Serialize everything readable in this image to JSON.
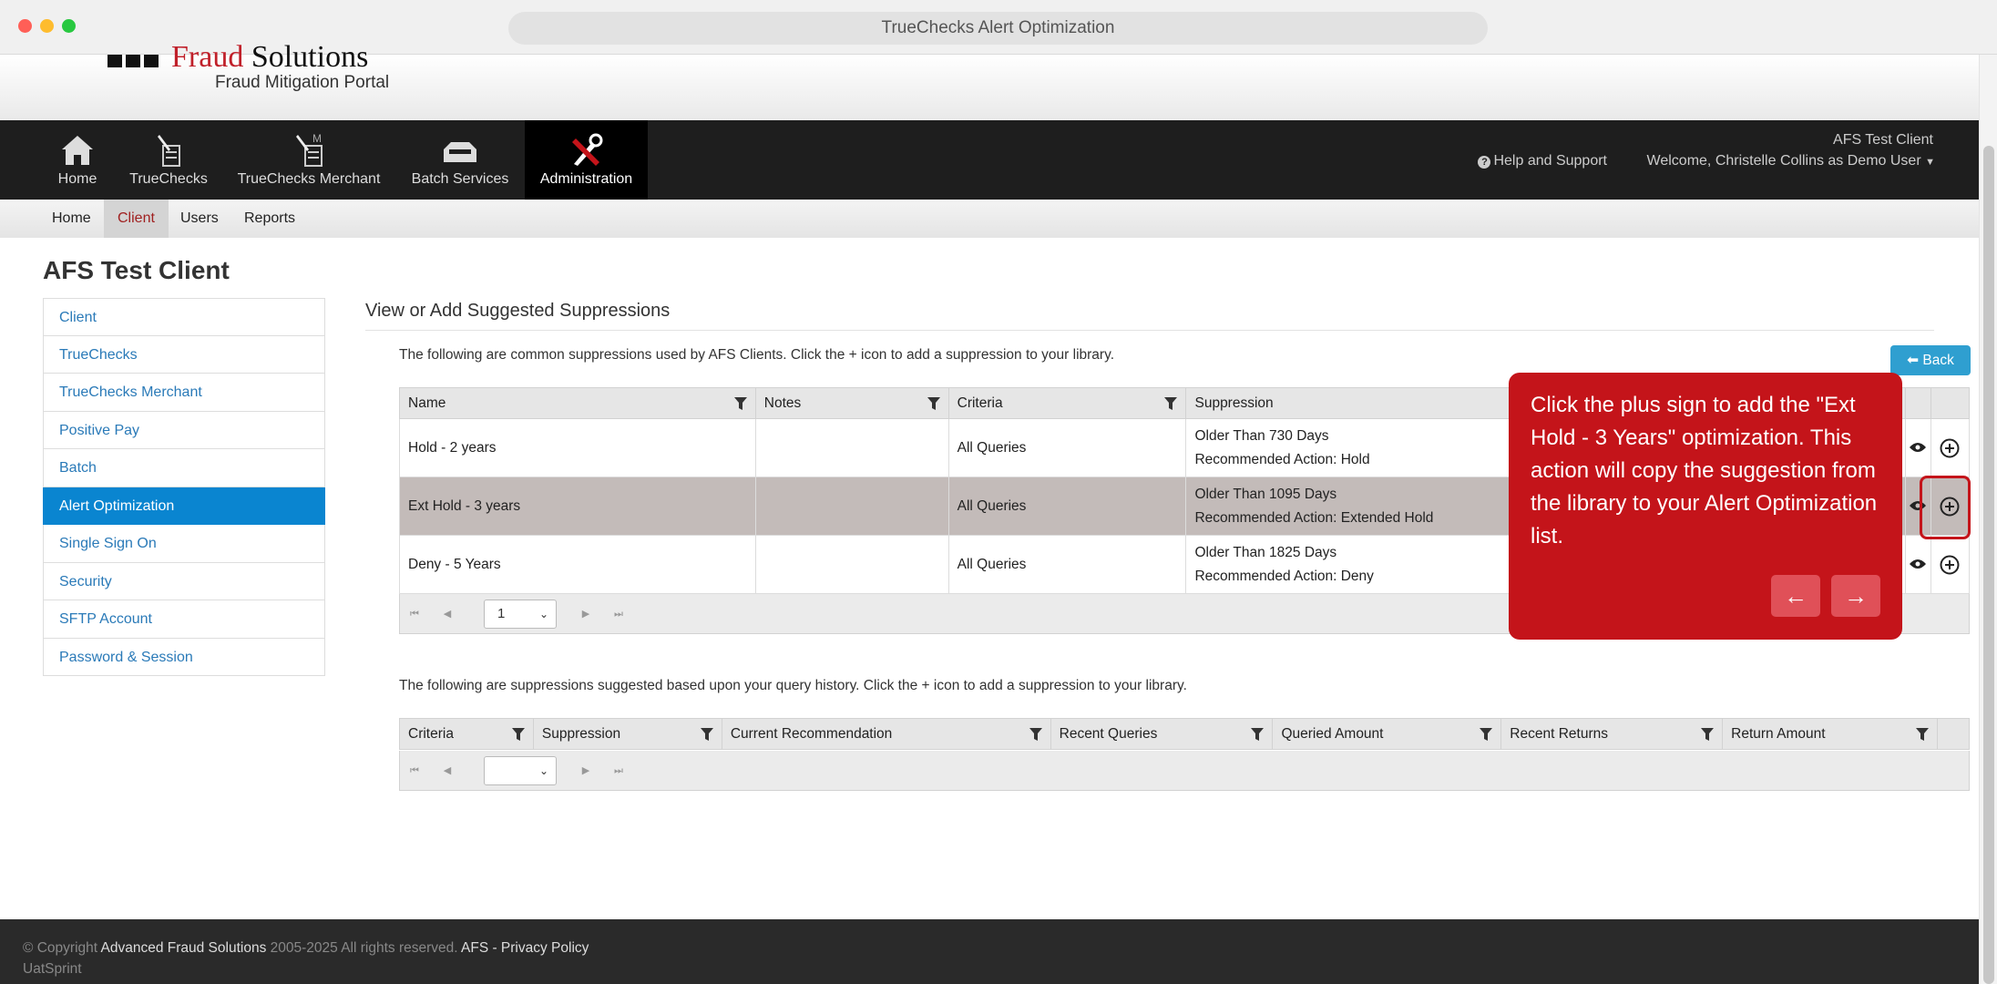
{
  "window": {
    "url_title": "TrueChecks Alert Optimization"
  },
  "header": {
    "logo_name_dark": "",
    "logo_name_red": "Fraud",
    "logo_name_dark2": " Solutions",
    "logo_sub": "Fraud Mitigation Portal",
    "client_label": "AFS Test Client",
    "help": "Help and Support",
    "welcome": "Welcome, Christelle Collins as Demo User"
  },
  "nav": [
    {
      "label": "Home",
      "icon": "home-icon"
    },
    {
      "label": "TrueChecks",
      "icon": "check-pen-icon"
    },
    {
      "label": "TrueChecks Merchant",
      "icon": "merchant-check-icon"
    },
    {
      "label": "Batch Services",
      "icon": "inbox-tray-icon"
    },
    {
      "label": "Administration",
      "icon": "tools-icon"
    }
  ],
  "subnav": [
    "Home",
    "Client",
    "Users",
    "Reports"
  ],
  "page_title": "AFS Test Client",
  "sidebar": [
    "Client",
    "TrueChecks",
    "TrueChecks Merchant",
    "Positive Pay",
    "Batch",
    "Alert Optimization",
    "Single Sign On",
    "Security",
    "SFTP Account",
    "Password & Session"
  ],
  "section_title": "View or Add Suggested Suppressions",
  "intro1": "The following are common suppressions used by AFS Clients. Click the + icon to add a suppression to your library.",
  "intro2": "The following are suppressions suggested based upon your query history. Click the + icon to add a suppression to your library.",
  "back_label": "Back",
  "table1": {
    "headers": [
      "Name",
      "Notes",
      "Criteria",
      "Suppression"
    ],
    "rows": [
      {
        "name": "Hold - 2 years",
        "notes": "",
        "criteria": "All Queries",
        "supp1": "Older Than 730 Days",
        "supp2": "Recommended Action: Hold"
      },
      {
        "name": "Ext Hold - 3 years",
        "notes": "",
        "criteria": "All Queries",
        "supp1": "Older Than 1095 Days",
        "supp2": "Recommended Action: Extended Hold"
      },
      {
        "name": "Deny - 5 Years",
        "notes": "",
        "criteria": "All Queries",
        "supp1": "Older Than 1825 Days",
        "supp2": "Recommended Action: Deny"
      }
    ],
    "page": "1"
  },
  "table2": {
    "headers": [
      "Criteria",
      "Suppression",
      "Current Recommendation",
      "Recent Queries",
      "Queried Amount",
      "Recent Returns",
      "Return Amount"
    ],
    "page": ""
  },
  "tooltip": {
    "text": "Click the plus sign to add the \"Ext Hold - 3 Years\" optimization. This action will copy the suggestion from the library to your Alert Optimization list."
  },
  "footer": {
    "copy_prefix": "© Copyright ",
    "company": "Advanced Fraud Solutions",
    "years": " 2005-2025 All rights reserved. ",
    "link": "AFS - Privacy Policy",
    "env": "UatSprint"
  },
  "colors": {
    "accent_red": "#c4141a",
    "sidebar_active": "#0a85d0",
    "back_button": "#2f9fd0"
  }
}
